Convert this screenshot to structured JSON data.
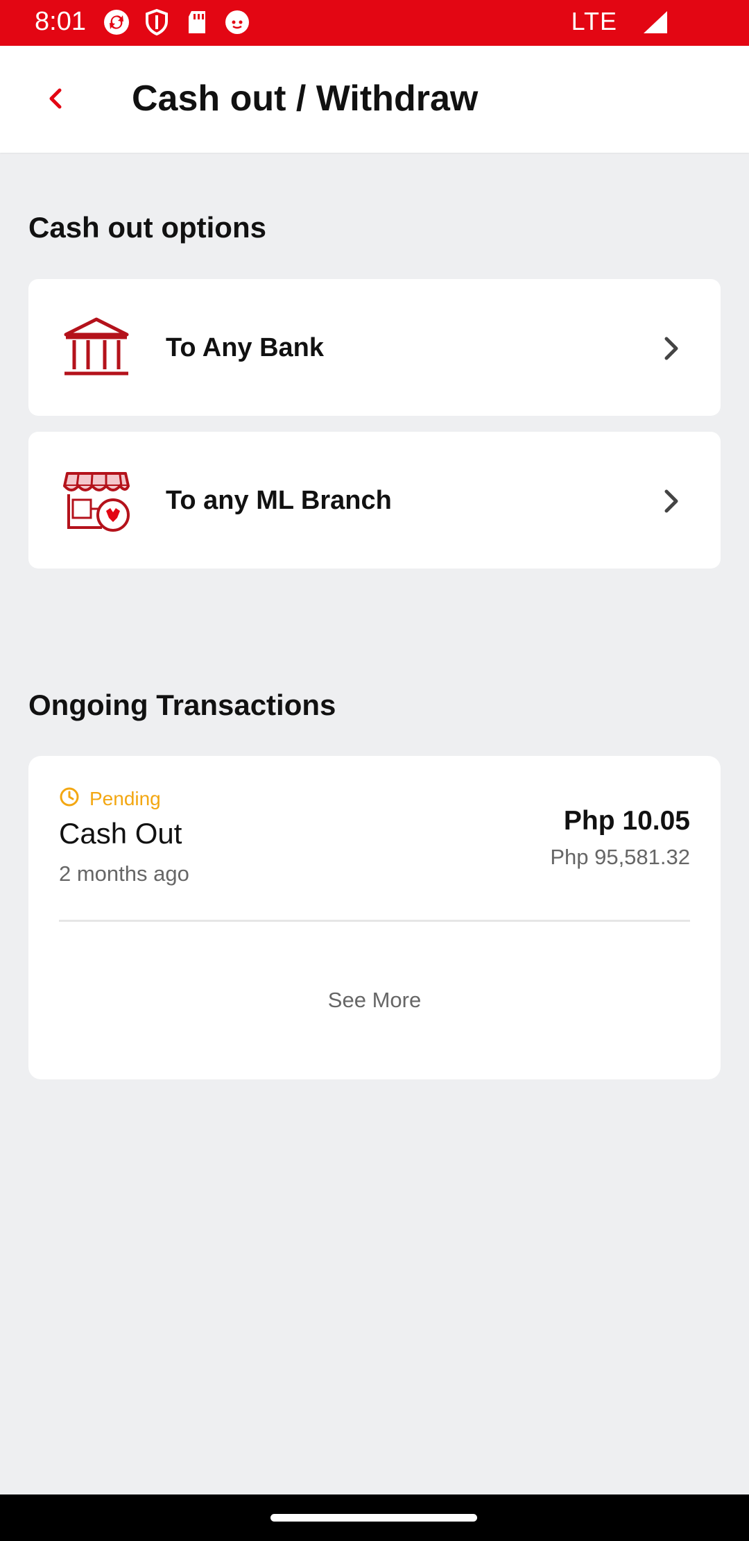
{
  "status_bar": {
    "time": "8:01",
    "network": "LTE"
  },
  "header": {
    "title": "Cash out / Withdraw",
    "back_icon": "chevron-left-icon"
  },
  "cash_out": {
    "section_title": "Cash out options",
    "options": [
      {
        "label": "To Any Bank",
        "icon": "bank-icon"
      },
      {
        "label": "To any ML Branch",
        "icon": "store-icon"
      }
    ]
  },
  "ongoing": {
    "section_title": "Ongoing Transactions",
    "transactions": [
      {
        "status": "Pending",
        "title": "Cash Out",
        "time": "2 months ago",
        "amount": "Php 10.05",
        "balance": "Php 95,581.32"
      }
    ],
    "see_more": "See More"
  },
  "colors": {
    "brand_red": "#E30613",
    "icon_red": "#B4121B",
    "pending": "#F3A712",
    "background": "#EEEFF1"
  }
}
